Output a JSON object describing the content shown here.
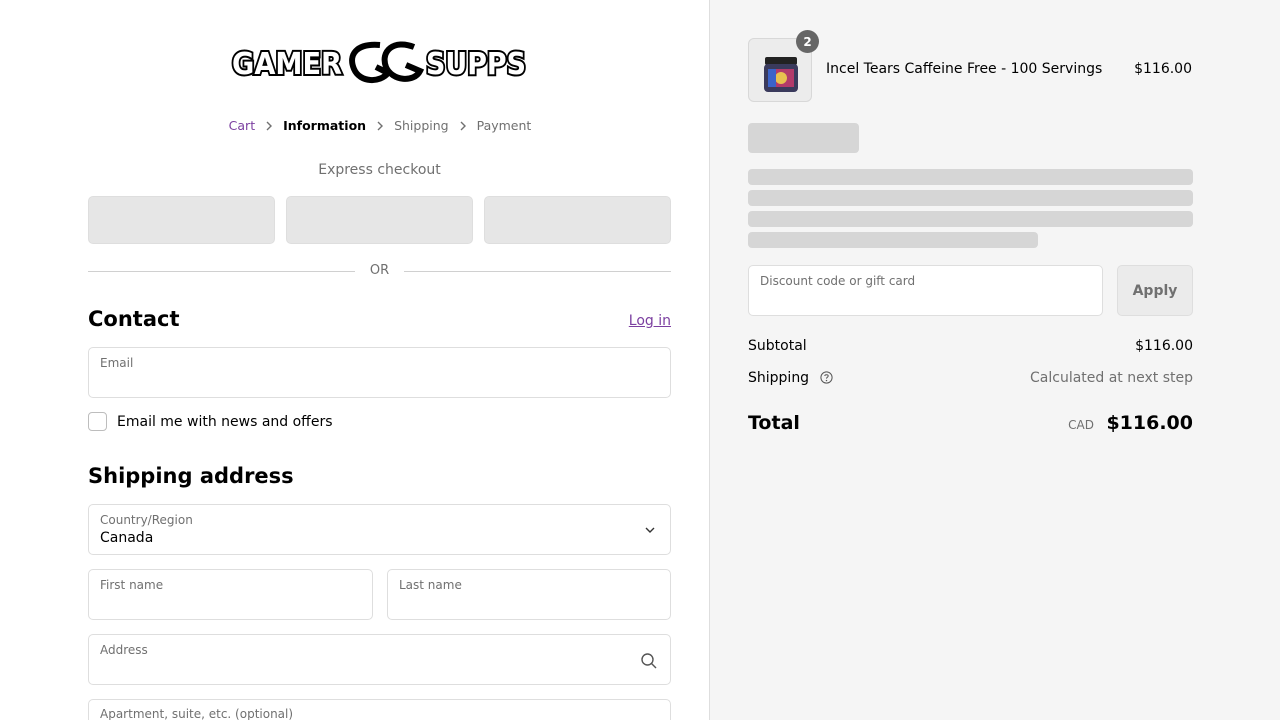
{
  "brand": {
    "logo_text": "GAMER GG SUPPS"
  },
  "breadcrumb": {
    "items": [
      {
        "label": "Cart"
      },
      {
        "label": "Information"
      },
      {
        "label": "Shipping"
      },
      {
        "label": "Payment"
      }
    ]
  },
  "express": {
    "title": "Express checkout",
    "or_label": "OR"
  },
  "contact": {
    "heading": "Contact",
    "login_label": "Log in",
    "email_label": "Email",
    "newsletter_label": "Email me with news and offers"
  },
  "shipping_address": {
    "heading": "Shipping address",
    "country_label": "Country/Region",
    "country_value": "Canada",
    "first_name_label": "First name",
    "last_name_label": "Last name",
    "address_label": "Address",
    "apartment_label": "Apartment, suite, etc. (optional)"
  },
  "order": {
    "product": {
      "name": "Incel Tears Caffeine Free - 100 Servings",
      "price": "$116.00",
      "quantity": "2"
    },
    "discount_label": "Discount code or gift card",
    "apply_label": "Apply",
    "subtotal_label": "Subtotal",
    "subtotal_value": "$116.00",
    "shipping_label": "Shipping",
    "shipping_value": "Calculated at next step",
    "total_label": "Total",
    "total_currency": "CAD",
    "total_value": "$116.00"
  }
}
